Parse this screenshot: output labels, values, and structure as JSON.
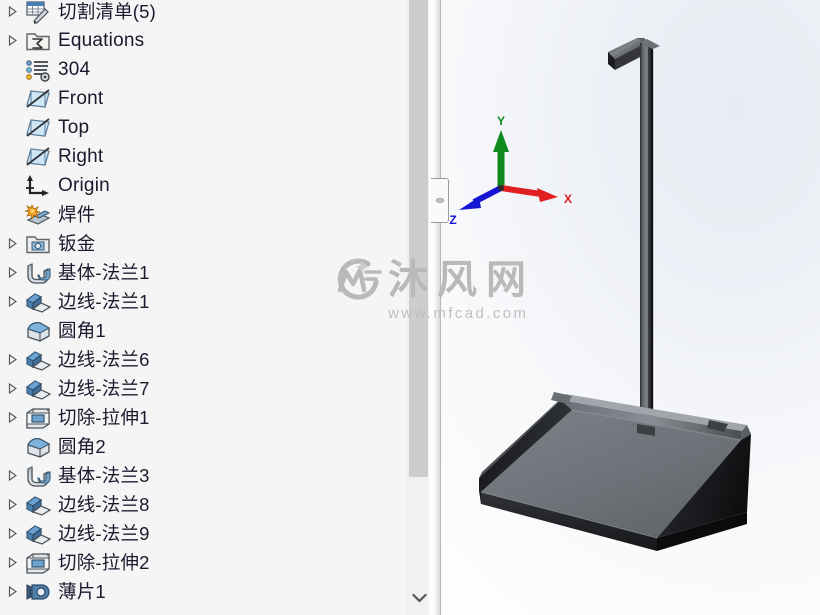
{
  "app": {
    "kind": "solidworks-feature-manager-design-tree"
  },
  "tree": {
    "nodes": [
      {
        "label": "切割清单(5)",
        "icon": "cut-list-icon",
        "expandable": true,
        "script": "cjk"
      },
      {
        "label": "Equations",
        "icon": "equations-folder-icon",
        "expandable": true,
        "script": "latin"
      },
      {
        "label": "304",
        "icon": "material-icon",
        "expandable": false,
        "script": "latin"
      },
      {
        "label": "Front",
        "icon": "plane-icon",
        "expandable": false,
        "script": "latin"
      },
      {
        "label": "Top",
        "icon": "plane-icon",
        "expandable": false,
        "script": "latin"
      },
      {
        "label": "Right",
        "icon": "plane-icon",
        "expandable": false,
        "script": "latin"
      },
      {
        "label": "Origin",
        "icon": "origin-axis-icon",
        "expandable": false,
        "script": "latin"
      },
      {
        "label": "焊件",
        "icon": "weldment-icon",
        "expandable": false,
        "script": "cjk"
      },
      {
        "label": "钣金",
        "icon": "sheet-metal-folder-icon",
        "expandable": true,
        "script": "cjk"
      },
      {
        "label": "基体-法兰1",
        "icon": "base-flange-icon",
        "expandable": true,
        "script": "cjk"
      },
      {
        "label": "边线-法兰1",
        "icon": "edge-flange-icon",
        "expandable": true,
        "script": "cjk"
      },
      {
        "label": "圆角1",
        "icon": "fillet-icon",
        "expandable": false,
        "script": "cjk"
      },
      {
        "label": "边线-法兰6",
        "icon": "edge-flange-icon",
        "expandable": true,
        "script": "cjk"
      },
      {
        "label": "边线-法兰7",
        "icon": "edge-flange-icon",
        "expandable": true,
        "script": "cjk"
      },
      {
        "label": "切除-拉伸1",
        "icon": "cut-extrude-icon",
        "expandable": true,
        "script": "cjk"
      },
      {
        "label": "圆角2",
        "icon": "fillet-icon",
        "expandable": false,
        "script": "cjk"
      },
      {
        "label": "基体-法兰3",
        "icon": "base-flange-icon",
        "expandable": true,
        "script": "cjk"
      },
      {
        "label": "边线-法兰8",
        "icon": "edge-flange-icon",
        "expandable": true,
        "script": "cjk"
      },
      {
        "label": "边线-法兰9",
        "icon": "edge-flange-icon",
        "expandable": true,
        "script": "cjk"
      },
      {
        "label": "切除-拉伸2",
        "icon": "cut-extrude-icon",
        "expandable": true,
        "script": "cjk"
      },
      {
        "label": "薄片1",
        "icon": "tab-icon",
        "expandable": true,
        "script": "cjk"
      }
    ]
  },
  "scrollbar": {
    "down_arrow_icon": "chevron-down-icon"
  },
  "splitter": {
    "handle_icon": "splitter-grip-icon"
  },
  "viewport": {
    "model_name": "dustpan-sheet-metal-model",
    "triad": {
      "x_label": "X",
      "y_label": "Y",
      "z_label": "Z",
      "x_color": "#e02020",
      "y_color": "#0f8a1e",
      "z_color": "#1414d2"
    }
  },
  "watermark": {
    "logo": "mf-logo-icon",
    "text": "沐风网",
    "url": "www.mfcad.com"
  }
}
